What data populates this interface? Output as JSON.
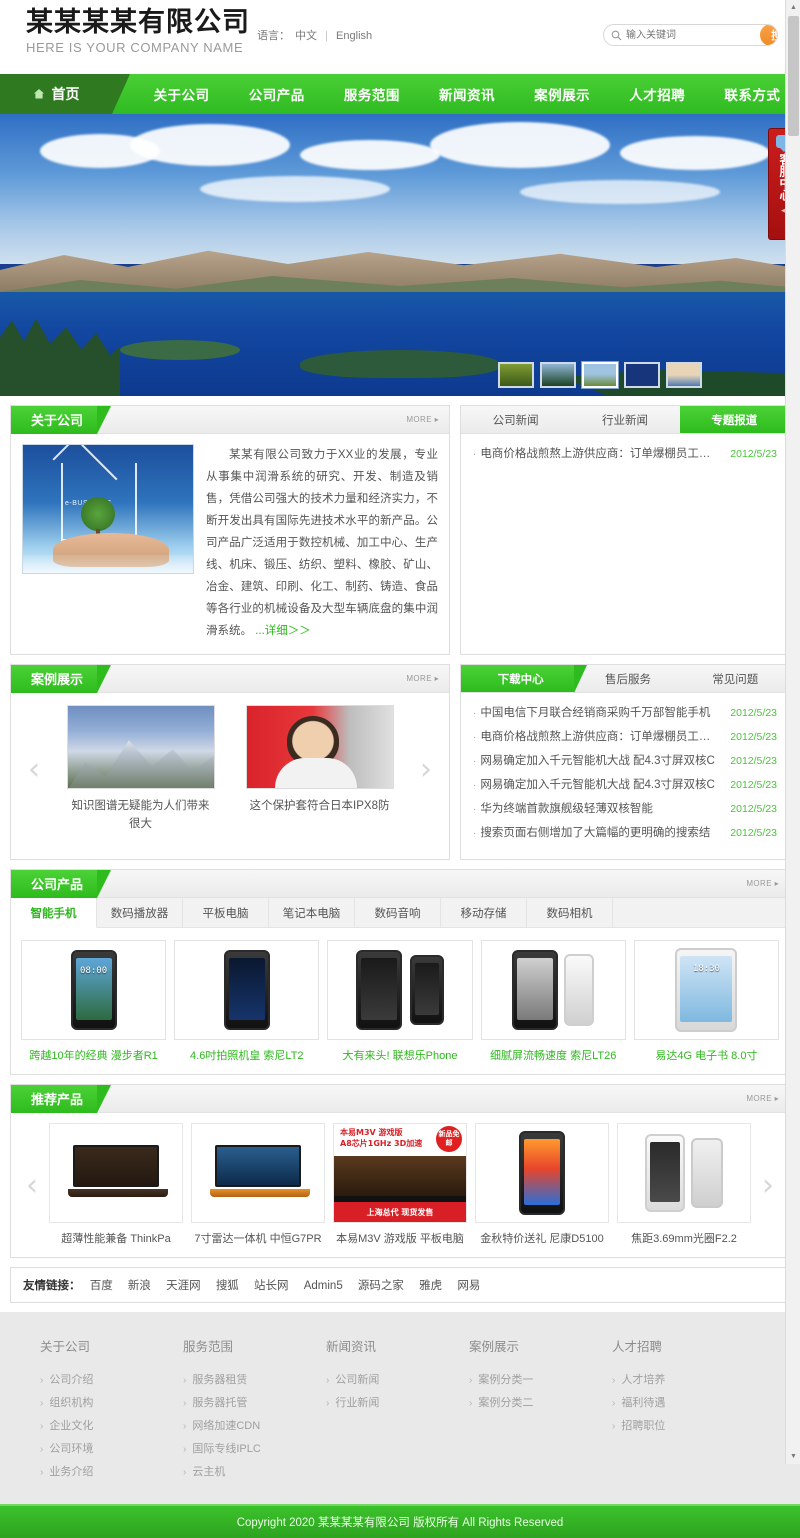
{
  "header": {
    "company_cn": "某某某某有限公司",
    "company_en": "HERE IS YOUR COMPANY NAME",
    "lang_label": "语言：",
    "lang_cn": "中文",
    "lang_sep": "|",
    "lang_en": "English",
    "search_placeholder": "输入关键词",
    "search_button": "搜 索"
  },
  "nav": {
    "home": "首页",
    "items": [
      "关于公司",
      "公司产品",
      "服务范围",
      "新闻资讯",
      "案例展示",
      "人才招聘",
      "联系方式"
    ]
  },
  "customer_service": {
    "label": "客服中心",
    "arrow": "◀"
  },
  "banner": {
    "thumbs": [
      "1",
      "2",
      "3",
      "4",
      "5"
    ],
    "active_index": 2
  },
  "about": {
    "title": "关于公司",
    "more": "MORE ▸",
    "image_label": "e-BUSINESS",
    "body": "某某有限公司致力于XX业的发展，专业从事集中润滑系统的研究、开发、制造及销售，凭借公司强大的技术力量和经济实力，不断开发出具有国际先进技术水平的新产品。公司产品广泛适用于数控机械、加工中心、生产线、机床、锻压、纺织、塑料、橡胶、矿山、冶金、建筑、印刷、化工、制药、铸造、食品等各行业的机械设备及大型车辆底盘的集中润滑系统。",
    "more_inline": "...详细＞＞"
  },
  "news": {
    "tabs": [
      "公司新闻",
      "行业新闻",
      "专题报道"
    ],
    "active_tab": 2,
    "items": [
      {
        "title": "电商价格战煎熬上游供应商：订单爆棚员工抓狂",
        "date": "2012/5/23"
      }
    ]
  },
  "cases": {
    "title": "案例展示",
    "more": "MORE ▸",
    "prev": "‹",
    "next": "›",
    "items": [
      {
        "caption": "知识图谱无疑能为人们带来很大"
      },
      {
        "caption": "这个保护套符合日本IPX8防"
      }
    ]
  },
  "download": {
    "tabs": [
      "下载中心",
      "售后服务",
      "常见问题"
    ],
    "active_tab": 0,
    "items": [
      {
        "title": "中国电信下月联合经销商采购千万部智能手机",
        "date": "2012/5/23"
      },
      {
        "title": "电商价格战煎熬上游供应商：订单爆棚员工抓狂",
        "date": "2012/5/23"
      },
      {
        "title": "网易确定加入千元智能机大战 配4.3寸屏双核C",
        "date": "2012/5/23"
      },
      {
        "title": "网易确定加入千元智能机大战 配4.3寸屏双核C",
        "date": "2012/5/23"
      },
      {
        "title": "华为终端首款旗舰级轻薄双核智能",
        "date": "2012/5/23"
      },
      {
        "title": "搜索页面右侧增加了大篇幅的更明确的搜索结",
        "date": "2012/5/23"
      }
    ]
  },
  "products": {
    "title": "公司产品",
    "more": "MORE ▸",
    "tabs": [
      "智能手机",
      "数码播放器",
      "平板电脑",
      "笔记本电脑",
      "数码音响",
      "移动存储",
      "数码相机"
    ],
    "active_tab": 0,
    "items": [
      {
        "caption": "跨越10年的经典 漫步者R1",
        "time": "08:00"
      },
      {
        "caption": "4.6吋拍照机皇 索尼LT2",
        "time": ""
      },
      {
        "caption": "大有来头! 联想乐Phone",
        "time": ""
      },
      {
        "caption": "细腻屏流畅速度 索尼LT26",
        "time": ""
      },
      {
        "caption": "易达4G 电子书 8.0寸",
        "time": "18:30"
      }
    ]
  },
  "recommended": {
    "title": "推荐产品",
    "more": "MORE ▸",
    "prev": "‹",
    "next": "›",
    "items": [
      {
        "caption": "超薄性能兼备 ThinkPa"
      },
      {
        "caption": "7寸雷达一体机 中恒G7PR"
      },
      {
        "caption": "本易M3V 游戏版 平板电脑"
      },
      {
        "caption": "金秋特价送礼 尼康D5100"
      },
      {
        "caption": "焦距3.69mm光圈F2.2"
      }
    ],
    "promo": {
      "line1": "本易M3V 游戏版",
      "line2": "A8芯片1GHz 3D加速",
      "badge": "新品免邮",
      "bottom": "上海总代 现货发售"
    }
  },
  "friendly_links": {
    "label": "友情链接：",
    "items": [
      "百度",
      "新浪",
      "天涯网",
      "搜狐",
      "站长网",
      "Admin5",
      "源码之家",
      "雅虎",
      "网易"
    ]
  },
  "footer": {
    "chevron": "›",
    "columns": [
      {
        "title": "关于公司",
        "links": [
          "公司介绍",
          "组织机构",
          "企业文化",
          "公司环境",
          "业务介绍"
        ]
      },
      {
        "title": "服务范围",
        "links": [
          "服务器租赁",
          "服务器托管",
          "网络加速CDN",
          "国际专线IPLC",
          "云主机"
        ]
      },
      {
        "title": "新闻资讯",
        "links": [
          "公司新闻",
          "行业新闻"
        ]
      },
      {
        "title": "案例展示",
        "links": [
          "案例分类一",
          "案例分类二"
        ]
      },
      {
        "title": "人才招聘",
        "links": [
          "人才培养",
          "福利待遇",
          "招聘职位"
        ]
      }
    ],
    "copyright": "Copyright 2020 某某某某有限公司 版权所有 All Rights Reserved"
  },
  "scrollbar": {
    "up": "▲",
    "down": "▼"
  }
}
